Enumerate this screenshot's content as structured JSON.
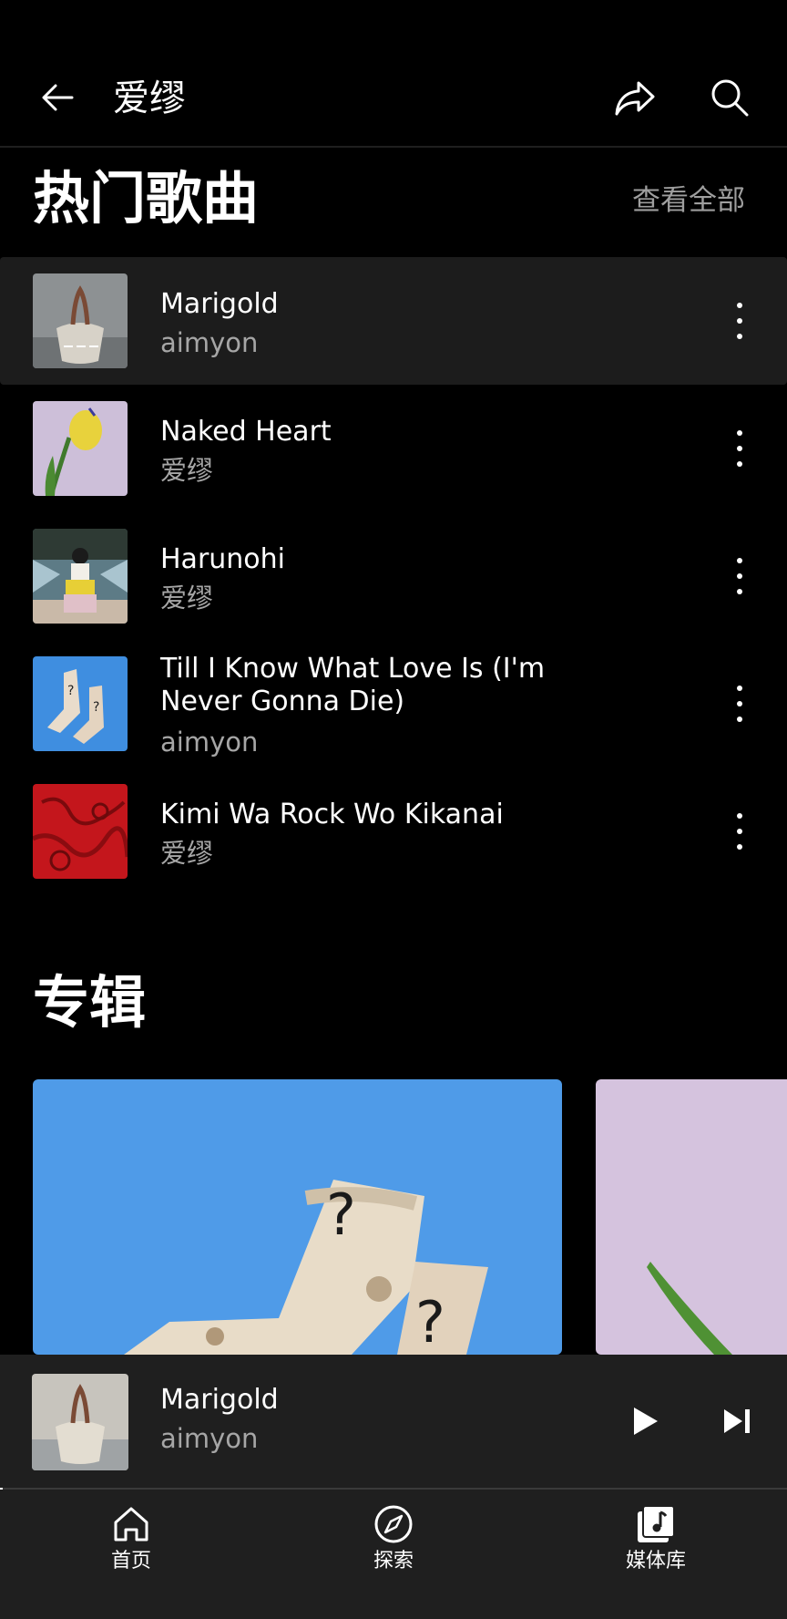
{
  "header": {
    "title": "爱缪",
    "back_icon": "arrow-left-icon",
    "share_icon": "share-icon",
    "search_icon": "search-icon"
  },
  "top_songs": {
    "title": "热门歌曲",
    "see_all": "查看全部",
    "items": [
      {
        "title": "Marigold",
        "artist": "aimyon",
        "active": true,
        "art_colors": [
          "#8a8d8f",
          "#5c5a55"
        ]
      },
      {
        "title": "Naked Heart",
        "artist": "爱缪",
        "active": false,
        "art_colors": [
          "#c9b7d6",
          "#e6d24a"
        ]
      },
      {
        "title": "Harunohi",
        "artist": "爱缪",
        "active": false,
        "art_colors": [
          "#5b7a8a",
          "#e8d24a"
        ]
      },
      {
        "title": "Till I Know What Love Is (I'm Never Gonna Die)",
        "artist": "aimyon",
        "active": false,
        "art_colors": [
          "#3f8ee0",
          "#e9dccb"
        ]
      },
      {
        "title": "Kimi Wa Rock Wo Kikanai",
        "artist": "爱缪",
        "active": false,
        "art_colors": [
          "#c4161c",
          "#7a0a0d"
        ]
      }
    ]
  },
  "albums": {
    "title": "专辑"
  },
  "mini_player": {
    "title": "Marigold",
    "artist": "aimyon",
    "progress": 0.003,
    "play_icon": "play-icon",
    "next_icon": "skip-next-icon"
  },
  "bottom_nav": [
    {
      "label": "首页",
      "icon": "home-icon"
    },
    {
      "label": "探索",
      "icon": "compass-icon"
    },
    {
      "label": "媒体库",
      "icon": "library-icon"
    }
  ],
  "colors": {
    "background": "#000000",
    "surface": "#1f1f1f",
    "active_row": "#1c1c1c",
    "secondary_text": "#a6a6a6"
  }
}
